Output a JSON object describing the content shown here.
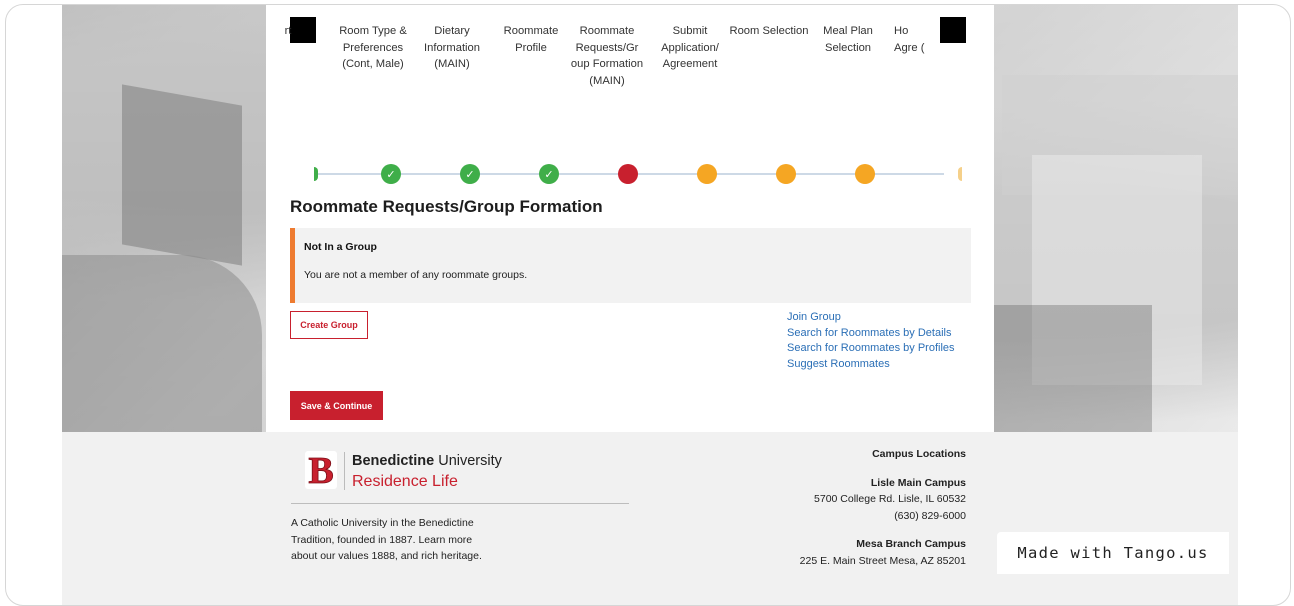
{
  "steps": {
    "labels": [
      "rt",
      "Room Type & Preferences (Cont, Male)",
      "Dietary Information (MAIN)",
      "Roommate Profile",
      "Roommate Requests/Gr oup Formation (MAIN)",
      "Submit Application/ Agreement",
      "Room Selection",
      "Meal Plan Selection",
      "Ho Agre ("
    ],
    "status": [
      "done",
      "done",
      "done",
      "current",
      "todo",
      "todo",
      "todo"
    ],
    "check_glyph": "✓"
  },
  "page": {
    "title": "Roommate Requests/Group Formation"
  },
  "notice": {
    "heading": "Not In a Group",
    "body": "You are not a member of any roommate groups."
  },
  "actions": {
    "create_group": "Create Group",
    "save_continue": "Save & Continue",
    "links": [
      "Join Group",
      "Search for Roommates by Details",
      "Search for Roommates by Profiles",
      "Suggest Roommates"
    ]
  },
  "footer": {
    "brand_bold": "Benedictine",
    "brand_rest": " University",
    "brand_sub": "Residence Life",
    "brand_letter": "B",
    "about": "A Catholic University in the Benedictine Tradition, founded in 1887. Learn more about our values 1888, and rich heritage.",
    "campus_heading": "Campus Locations",
    "campus1_name": "Lisle Main Campus",
    "campus1_addr": "5700 College Rd. Lisle, IL 60532",
    "campus1_phone": "(630) 829-6000",
    "campus2_name": "Mesa Branch Campus",
    "campus2_addr": "225 E. Main Street Mesa, AZ 85201"
  },
  "overlay": {
    "tango": "Made with Tango.us"
  },
  "colors": {
    "brand_red": "#c8202e",
    "done_green": "#3fae49",
    "todo_orange": "#f5a623",
    "notice_accent": "#ee7b30",
    "link_blue": "#2b6fb6"
  }
}
